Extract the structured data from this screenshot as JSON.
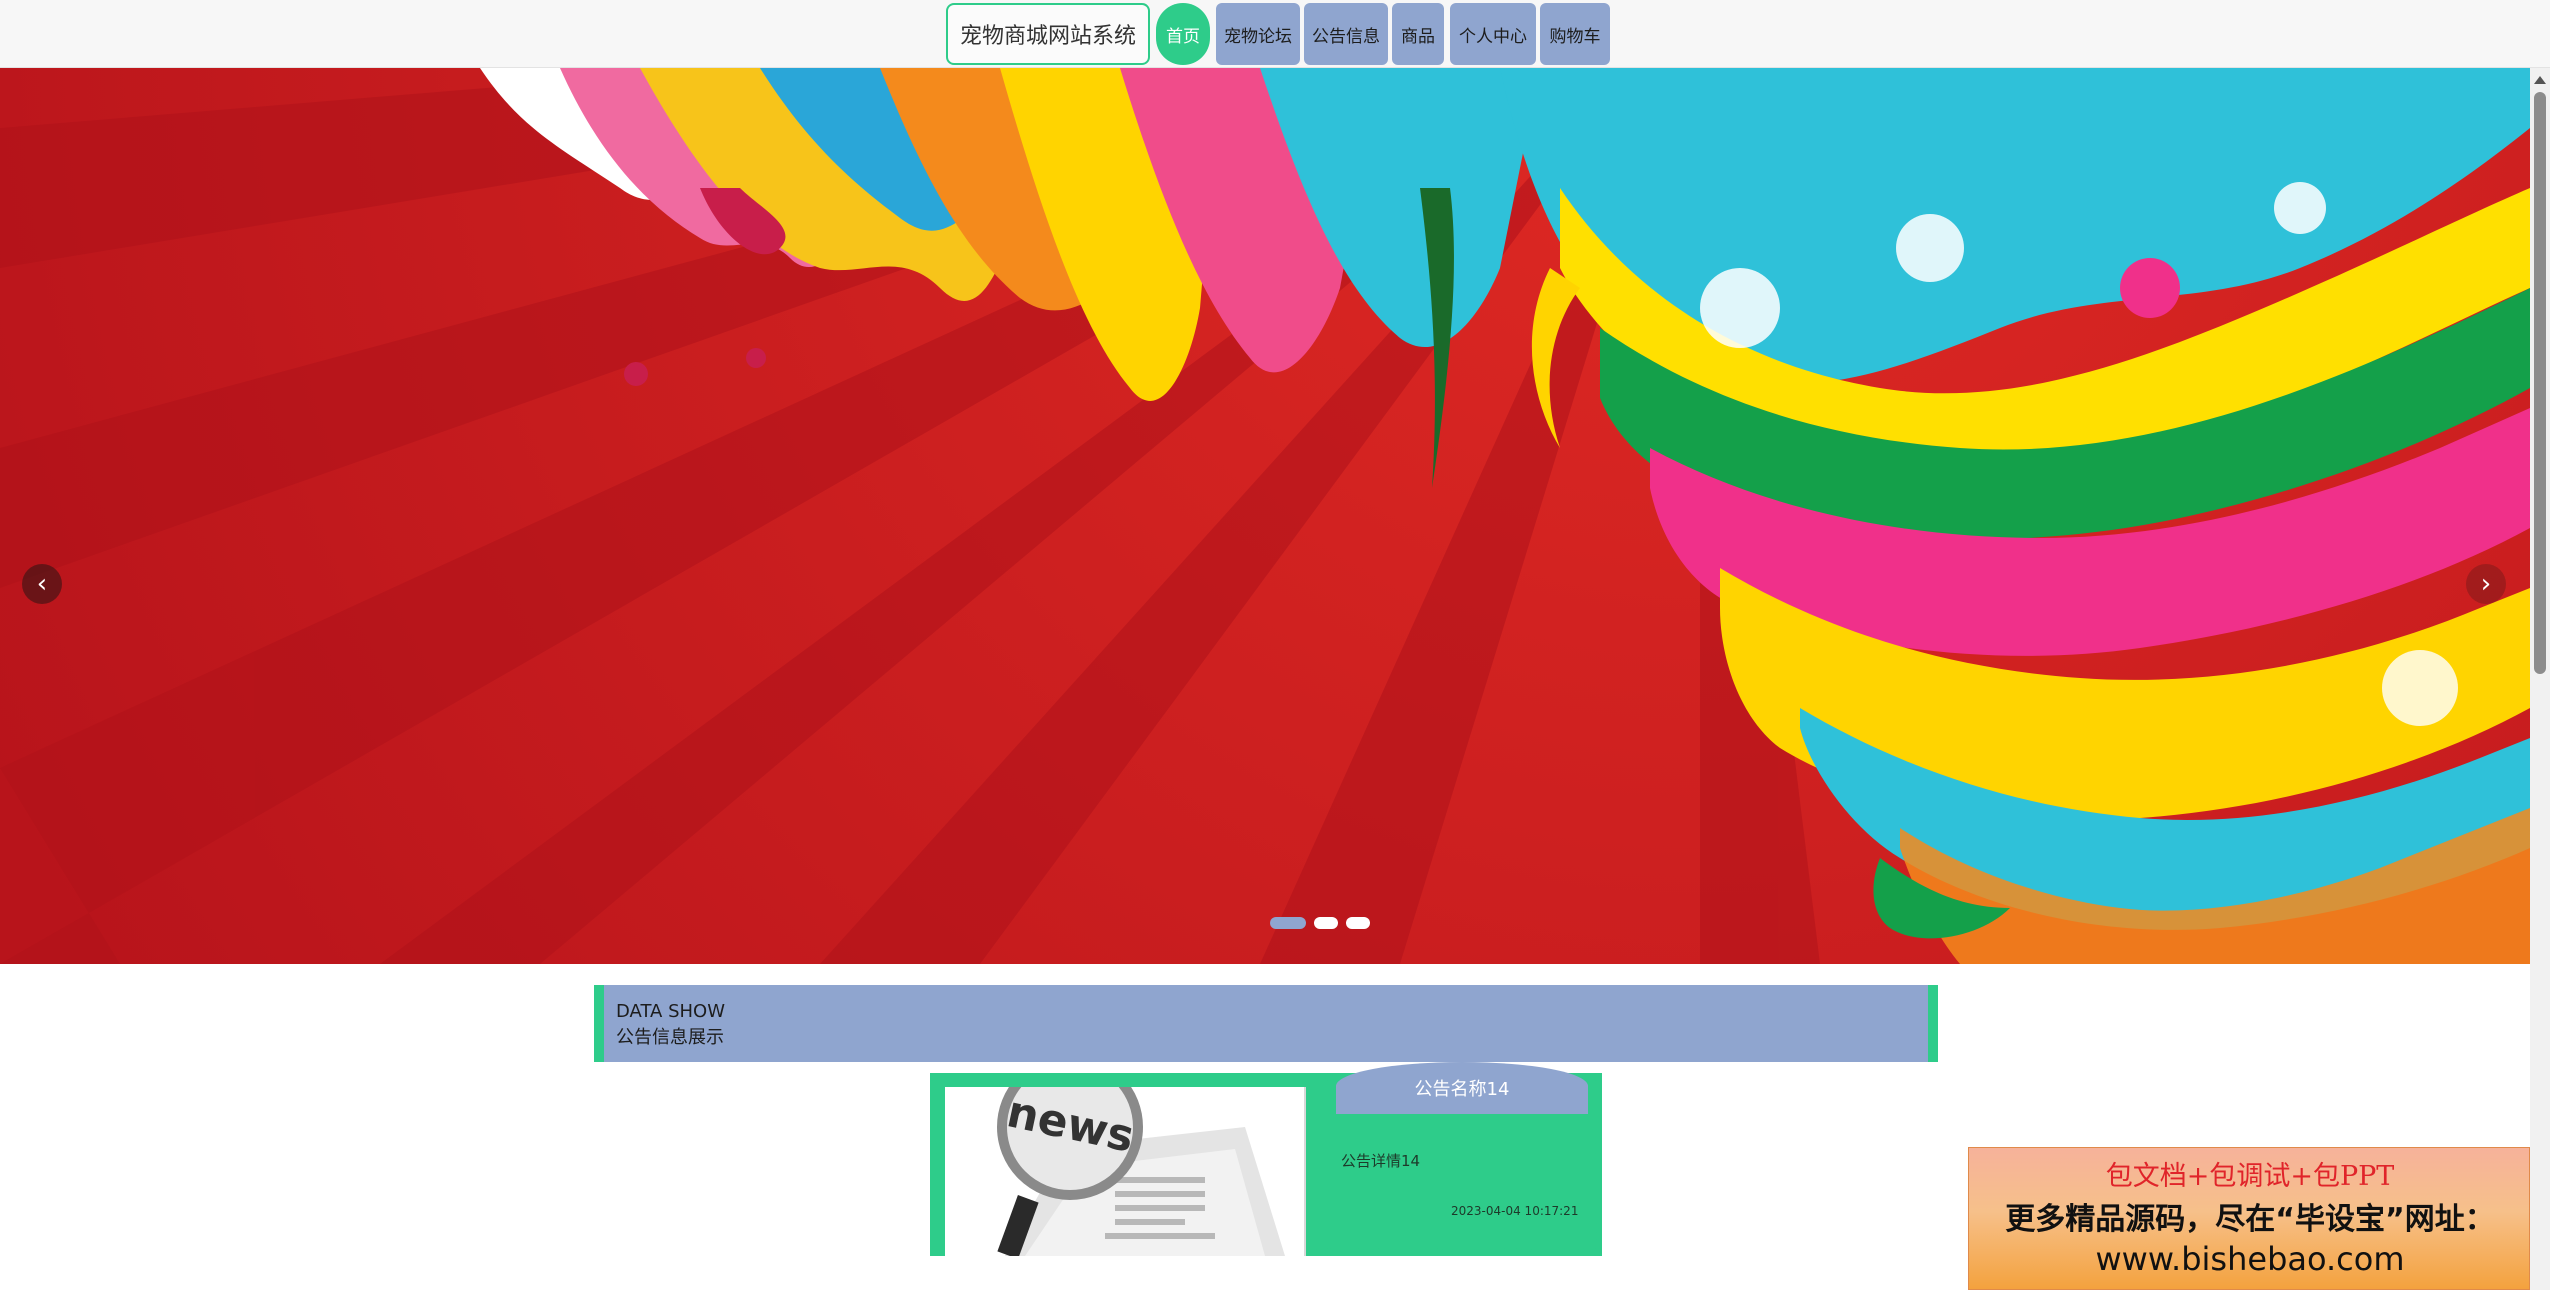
{
  "header": {
    "site_title": "宠物商城网站系统",
    "nav": [
      {
        "label": "首页",
        "active": true
      },
      {
        "label": "宠物论坛",
        "active": false
      },
      {
        "label": "公告信息",
        "active": false
      },
      {
        "label": "商品",
        "active": false
      },
      {
        "label": "个人中心",
        "active": false
      },
      {
        "label": "购物车",
        "active": false
      }
    ]
  },
  "carousel": {
    "prev_icon": "chevron-left-icon",
    "next_icon": "chevron-right-icon",
    "prev_glyph": "‹",
    "next_glyph": "›",
    "slide_count": 3,
    "active_index": 0
  },
  "section": {
    "title_en": "DATA SHOW",
    "title_cn": "公告信息展示"
  },
  "notice": {
    "name": "公告名称14",
    "detail": "公告详情14",
    "time": "2023-04-04 10:17:21",
    "image_text": "news"
  },
  "ad": {
    "line1": "包文档+包调试+包PPT",
    "line2": "更多精品源码，尽在“毕设宝”网址：",
    "line3": "www.bishebao.com"
  },
  "colors": {
    "accent_green": "#2ecc8a",
    "nav_blue": "#8fa5cf",
    "banner_red": "#c8191e"
  }
}
